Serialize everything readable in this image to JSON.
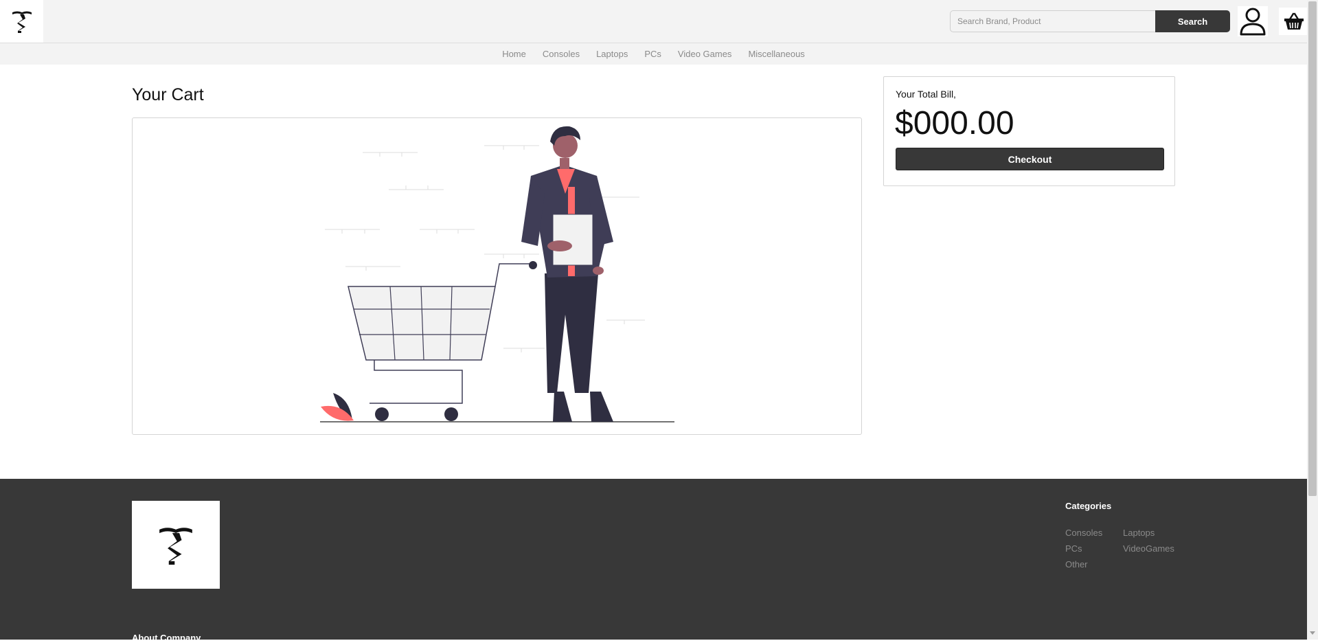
{
  "header": {
    "logo_icon": "t-monogram-logo",
    "search_placeholder": "Search Brand, Product",
    "search_value": "",
    "search_button_label": "Search",
    "user_icon": "user-icon",
    "cart_icon": "basket-icon"
  },
  "nav": {
    "items": [
      "Home",
      "Consoles",
      "Laptops",
      "PCs",
      "Video Games",
      "Miscellaneous"
    ]
  },
  "main": {
    "title": "Your Cart",
    "empty_cart_illustration": "empty-cart-illustration"
  },
  "bill": {
    "label": "Your Total Bill,",
    "amount": "$000.00",
    "checkout_label": "Checkout"
  },
  "footer": {
    "about_title": "About Company",
    "categories_title": "Categories",
    "categories": [
      "Consoles",
      "Laptops",
      "PCs",
      "VideoGames",
      "Other"
    ]
  },
  "colors": {
    "dark": "#383838",
    "header_bg": "#f3f3f3",
    "nav_text": "#8a8a8a",
    "accent_pink": "#ff6b6b"
  }
}
